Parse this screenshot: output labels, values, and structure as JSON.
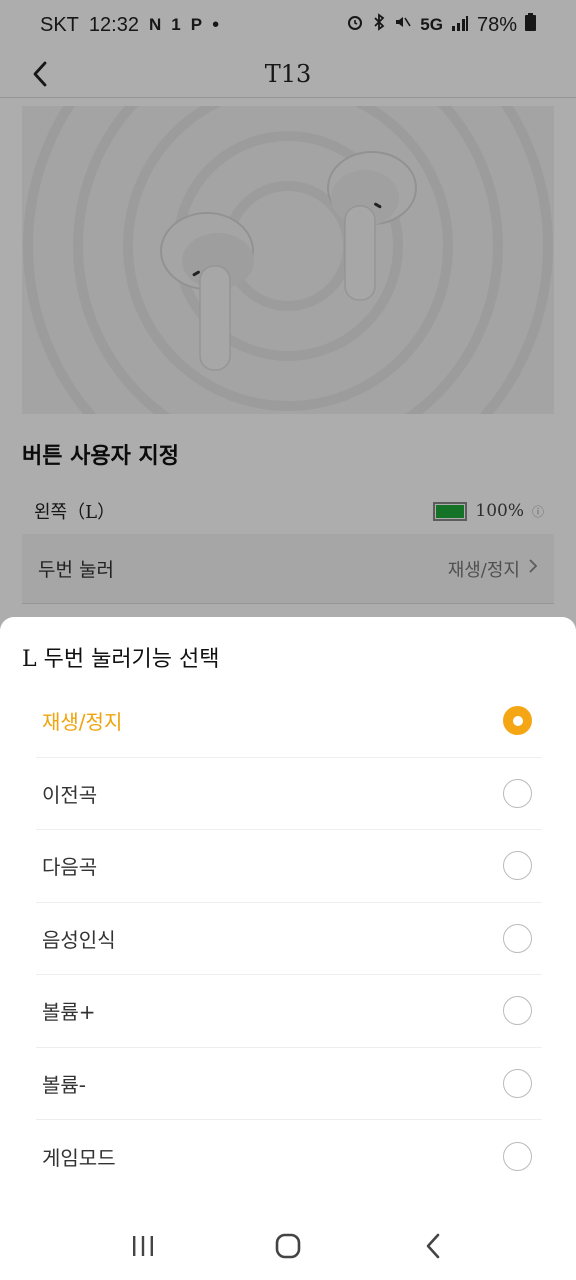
{
  "status_bar": {
    "carrier": "SKT",
    "time": "12:32",
    "battery": "78%",
    "icons": [
      "n-icon",
      "sim-icon",
      "p-icon",
      "dot-icon",
      "alarm-icon",
      "bluetooth-icon",
      "mute-icon",
      "5g-icon",
      "signal-icon",
      "battery-icon"
    ]
  },
  "app_bar": {
    "title": "T13",
    "back_icon": "chevron-left-icon"
  },
  "hero": {
    "image": "earbuds-image"
  },
  "section": {
    "title": "버튼 사용자 지정"
  },
  "left_earbud": {
    "label": "왼쪽（L）",
    "battery": "100%",
    "battery_fraction": 1.0
  },
  "double_tap_row": {
    "label": "두번 눌러",
    "value": "재생/정지"
  },
  "sheet": {
    "title": "L 두번 눌러기능 선택",
    "options": [
      {
        "label": "재생/정지",
        "selected": true
      },
      {
        "label": "이전곡",
        "selected": false
      },
      {
        "label": "다음곡",
        "selected": false
      },
      {
        "label": "음성인식",
        "selected": false
      },
      {
        "label": "볼륨+",
        "selected": false
      },
      {
        "label": "볼륨-",
        "selected": false
      },
      {
        "label": "게임모드",
        "selected": false
      }
    ]
  },
  "colors": {
    "accent": "#f5a614",
    "battery_green": "#1faa3a"
  },
  "nav_bar": {
    "icons": [
      "recents-icon",
      "home-icon",
      "back-icon"
    ]
  }
}
